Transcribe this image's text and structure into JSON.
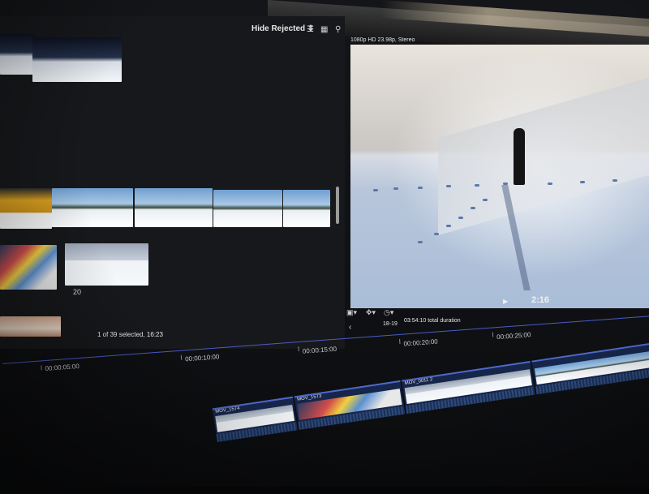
{
  "browser": {
    "filter_label": "Hide Rejected",
    "filter_icon": "up-down-chevron-icon",
    "toolbar_icons": [
      "list-view-icon",
      "filmstrip-icon",
      "search-icon"
    ],
    "clip_caption": "20",
    "status": "1 of 39 selected, 16:23"
  },
  "viewer": {
    "format": "1080p HD 23.98p, Stereo",
    "clip_name": "18-19",
    "timecode": "2:16"
  },
  "timeline": {
    "project_name": "18-19",
    "duration": "03:54:10 total duration",
    "ruler": [
      "00:00:05:00",
      "00:00:10:00",
      "00:00:15:00",
      "00:00:20:00",
      "00:00:25:00"
    ],
    "clips": [
      "MOV_1574",
      "MOV_1573",
      "MOV_0011 2"
    ]
  },
  "colors": {
    "accent_blue": "#4f68c8",
    "panel_bg": "#17181b"
  }
}
